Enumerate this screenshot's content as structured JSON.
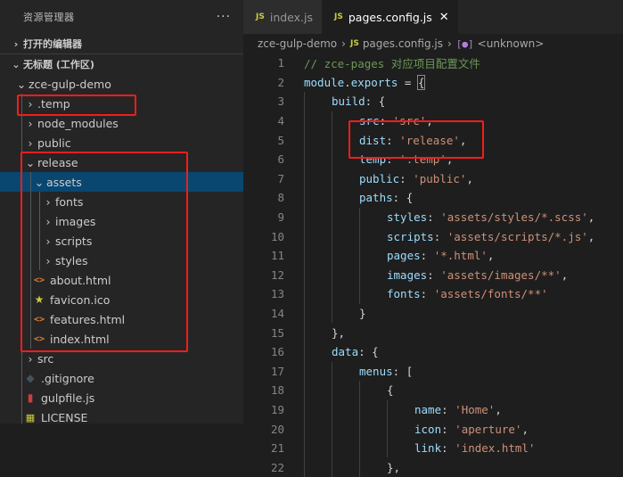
{
  "explorer": {
    "title": "资源管理器",
    "more": "···",
    "open_editors": "打开的编辑器",
    "workspace": "无标题 (工作区)",
    "tree": [
      {
        "label": "zce-gulp-demo",
        "depth": 0,
        "kind": "folder",
        "open": true
      },
      {
        "label": ".temp",
        "depth": 1,
        "kind": "folder",
        "open": false
      },
      {
        "label": "node_modules",
        "depth": 1,
        "kind": "folder",
        "open": false
      },
      {
        "label": "public",
        "depth": 1,
        "kind": "folder",
        "open": false
      },
      {
        "label": "release",
        "depth": 1,
        "kind": "folder",
        "open": true
      },
      {
        "label": "assets",
        "depth": 2,
        "kind": "folder",
        "open": true,
        "selected": true
      },
      {
        "label": "fonts",
        "depth": 3,
        "kind": "folder",
        "open": false
      },
      {
        "label": "images",
        "depth": 3,
        "kind": "folder",
        "open": false
      },
      {
        "label": "scripts",
        "depth": 3,
        "kind": "folder",
        "open": false
      },
      {
        "label": "styles",
        "depth": 3,
        "kind": "folder",
        "open": false
      },
      {
        "label": "about.html",
        "depth": 2,
        "kind": "html"
      },
      {
        "label": "favicon.ico",
        "depth": 2,
        "kind": "ico"
      },
      {
        "label": "features.html",
        "depth": 2,
        "kind": "html"
      },
      {
        "label": "index.html",
        "depth": 2,
        "kind": "html"
      },
      {
        "label": "src",
        "depth": 1,
        "kind": "folder",
        "open": false
      },
      {
        "label": ".gitignore",
        "depth": 1,
        "kind": "git"
      },
      {
        "label": "gulpfile.js",
        "depth": 1,
        "kind": "gulp"
      },
      {
        "label": "LICENSE",
        "depth": 1,
        "kind": "license"
      }
    ]
  },
  "tabs": [
    {
      "label": "index.js",
      "active": false
    },
    {
      "label": "pages.config.js",
      "active": true,
      "close": "✕"
    }
  ],
  "breadcrumb": [
    "zce-gulp-demo",
    "pages.config.js",
    "<unknown>"
  ],
  "code_lines": [
    {
      "n": "1",
      "indent": 0,
      "parts": [
        [
          "cm",
          "// zce-pages 对应项目配置文件"
        ]
      ]
    },
    {
      "n": "2",
      "indent": 0,
      "parts": [
        [
          "k",
          "module"
        ],
        [
          "p",
          "."
        ],
        [
          "k",
          "exports"
        ],
        [
          "p",
          " = "
        ],
        [
          "hl",
          "{"
        ]
      ]
    },
    {
      "n": "3",
      "indent": 1,
      "parts": [
        [
          "k",
          "build"
        ],
        [
          "p",
          ": {"
        ]
      ]
    },
    {
      "n": "4",
      "indent": 2,
      "parts": [
        [
          "k",
          "src"
        ],
        [
          "p",
          ": "
        ],
        [
          "s",
          "'src'"
        ],
        [
          "p",
          ","
        ]
      ]
    },
    {
      "n": "5",
      "indent": 2,
      "parts": [
        [
          "k",
          "dist"
        ],
        [
          "p",
          ": "
        ],
        [
          "s",
          "'release'"
        ],
        [
          "p",
          ","
        ]
      ]
    },
    {
      "n": "6",
      "indent": 2,
      "parts": [
        [
          "k",
          "temp"
        ],
        [
          "p",
          ": "
        ],
        [
          "s",
          "'.temp'"
        ],
        [
          "p",
          ","
        ]
      ]
    },
    {
      "n": "7",
      "indent": 2,
      "parts": [
        [
          "k",
          "public"
        ],
        [
          "p",
          ": "
        ],
        [
          "s",
          "'public'"
        ],
        [
          "p",
          ","
        ]
      ]
    },
    {
      "n": "8",
      "indent": 2,
      "parts": [
        [
          "k",
          "paths"
        ],
        [
          "p",
          ": {"
        ]
      ]
    },
    {
      "n": "9",
      "indent": 3,
      "parts": [
        [
          "k",
          "styles"
        ],
        [
          "p",
          ": "
        ],
        [
          "s",
          "'assets/styles/*.scss'"
        ],
        [
          "p",
          ","
        ]
      ]
    },
    {
      "n": "10",
      "indent": 3,
      "parts": [
        [
          "k",
          "scripts"
        ],
        [
          "p",
          ": "
        ],
        [
          "s",
          "'assets/scripts/*.js'"
        ],
        [
          "p",
          ","
        ]
      ]
    },
    {
      "n": "11",
      "indent": 3,
      "parts": [
        [
          "k",
          "pages"
        ],
        [
          "p",
          ": "
        ],
        [
          "s",
          "'*.html'"
        ],
        [
          "p",
          ","
        ]
      ]
    },
    {
      "n": "12",
      "indent": 3,
      "parts": [
        [
          "k",
          "images"
        ],
        [
          "p",
          ": "
        ],
        [
          "s",
          "'assets/images/**'"
        ],
        [
          "p",
          ","
        ]
      ]
    },
    {
      "n": "13",
      "indent": 3,
      "parts": [
        [
          "k",
          "fonts"
        ],
        [
          "p",
          ": "
        ],
        [
          "s",
          "'assets/fonts/**'"
        ]
      ]
    },
    {
      "n": "14",
      "indent": 2,
      "parts": [
        [
          "p",
          "}"
        ]
      ]
    },
    {
      "n": "15",
      "indent": 1,
      "parts": [
        [
          "p",
          "},"
        ]
      ]
    },
    {
      "n": "16",
      "indent": 1,
      "parts": [
        [
          "k",
          "data"
        ],
        [
          "p",
          ": {"
        ]
      ]
    },
    {
      "n": "17",
      "indent": 2,
      "parts": [
        [
          "k",
          "menus"
        ],
        [
          "p",
          ": ["
        ]
      ]
    },
    {
      "n": "18",
      "indent": 3,
      "parts": [
        [
          "p",
          "{"
        ]
      ]
    },
    {
      "n": "19",
      "indent": 4,
      "parts": [
        [
          "k",
          "name"
        ],
        [
          "p",
          ": "
        ],
        [
          "s",
          "'Home'"
        ],
        [
          "p",
          ","
        ]
      ]
    },
    {
      "n": "20",
      "indent": 4,
      "parts": [
        [
          "k",
          "icon"
        ],
        [
          "p",
          ": "
        ],
        [
          "s",
          "'aperture'"
        ],
        [
          "p",
          ","
        ]
      ]
    },
    {
      "n": "21",
      "indent": 4,
      "parts": [
        [
          "k",
          "link"
        ],
        [
          "p",
          ": "
        ],
        [
          "s",
          "'index.html'"
        ]
      ]
    },
    {
      "n": "22",
      "indent": 3,
      "parts": [
        [
          "p",
          "},"
        ]
      ]
    }
  ],
  "colors": {
    "accent_selected": "#094771",
    "annotation_red": "#f21d1d"
  }
}
